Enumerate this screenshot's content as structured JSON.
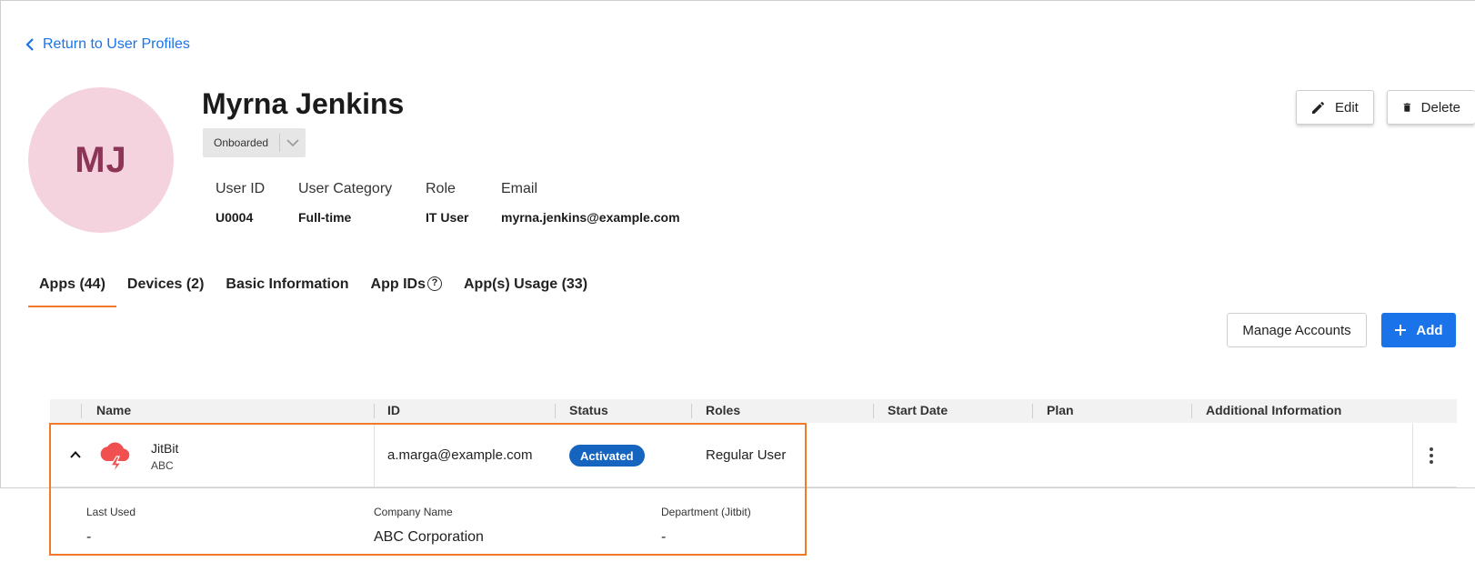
{
  "nav": {
    "back_label": "Return to User Profiles"
  },
  "user": {
    "initials": "MJ",
    "name": "Myrna Jenkins",
    "status": "Onboarded",
    "info": [
      {
        "label": "User ID",
        "value": "U0004"
      },
      {
        "label": "User Category",
        "value": "Full-time"
      },
      {
        "label": "Role",
        "value": "IT User"
      },
      {
        "label": "Email",
        "value": "myrna.jenkins@example.com"
      }
    ]
  },
  "actions": {
    "edit_label": "Edit",
    "delete_label": "Delete"
  },
  "tabs": [
    {
      "label": "Apps (44)",
      "active": true
    },
    {
      "label": "Devices (2)"
    },
    {
      "label": "Basic Information"
    },
    {
      "label": "App IDs",
      "help": "?"
    },
    {
      "label": "App(s) Usage (33)"
    }
  ],
  "toolbar": {
    "manage_label": "Manage Accounts",
    "add_label": "Add"
  },
  "table": {
    "columns": [
      "Name",
      "ID",
      "Status",
      "Roles",
      "Start Date",
      "Plan",
      "Additional Information"
    ],
    "rows": [
      {
        "app_name": "JitBit",
        "app_org": "ABC",
        "id": "a.marga@example.com",
        "status": "Activated",
        "roles": "Regular User",
        "details": [
          {
            "label": "Last Used",
            "value": "-"
          },
          {
            "label": "Company Name",
            "value": "ABC Corporation"
          },
          {
            "label": "Department (Jitbit)",
            "value": "-"
          }
        ]
      }
    ]
  },
  "colors": {
    "accent": "#1a73e8",
    "tab_underline": "#f07a28",
    "badge": "#1565c0",
    "avatar_bg": "#f5d3de",
    "avatar_text": "#8c3556",
    "highlight": "#f07a28",
    "app_logo": "#f05050"
  }
}
